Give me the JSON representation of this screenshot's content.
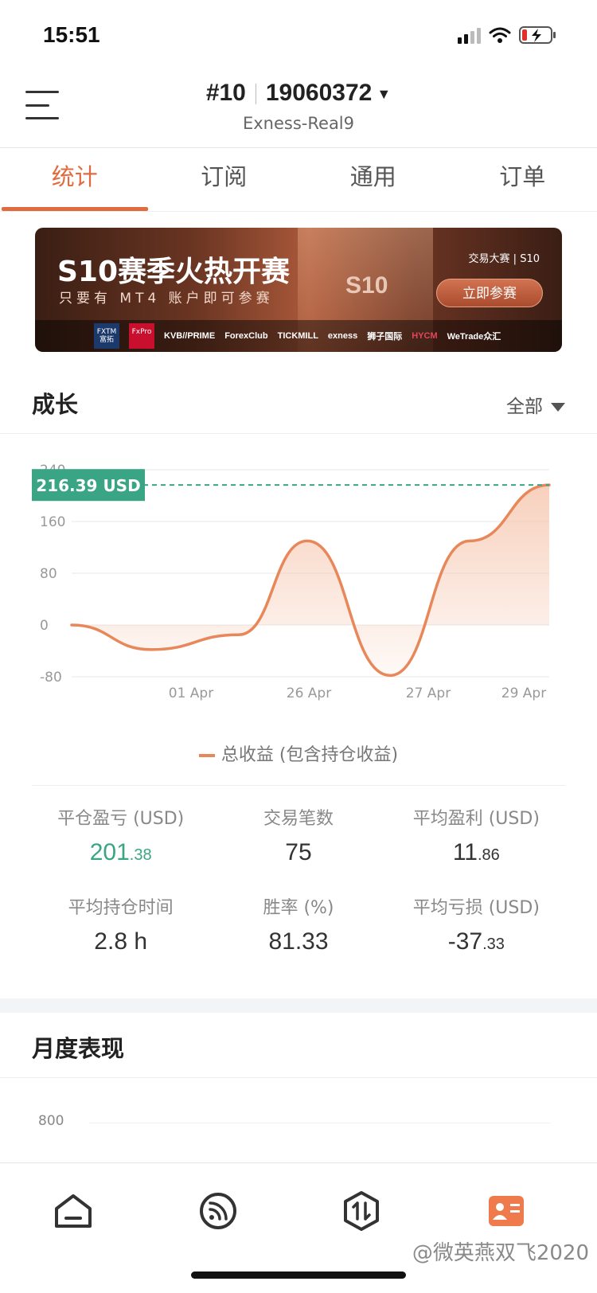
{
  "status_bar": {
    "time": "15:51"
  },
  "header": {
    "rank": "#10",
    "account_number": "19060372",
    "server": "Exness-Real9"
  },
  "tabs": [
    {
      "label": "统计",
      "active": true
    },
    {
      "label": "订阅",
      "active": false
    },
    {
      "label": "通用",
      "active": false
    },
    {
      "label": "订单",
      "active": false
    }
  ],
  "banner": {
    "title": "S10赛季火热开赛",
    "subtitle": "只要有 MT4 账户即可参赛",
    "brand": "交易大赛 | S10",
    "stage_mark": "S10",
    "cta": "立即参赛",
    "sponsors": [
      "FXTM 富拓",
      "FxPro",
      "KVB//PRIME",
      "ForexClub",
      "TICKMILL",
      "exness",
      "狮子国际",
      "HYCM",
      "WeTrade众汇"
    ]
  },
  "growth": {
    "title": "成长",
    "range": "全部",
    "current_label": "216.39 USD",
    "legend": "总收益 (包含持仓收益)"
  },
  "chart_data": {
    "type": "area",
    "x": [
      "",
      "",
      "01 Apr",
      "",
      "26 Apr",
      "",
      "27 Apr",
      "",
      "29 Apr"
    ],
    "xticks": [
      "01 Apr",
      "26 Apr",
      "27 Apr",
      "29 Apr"
    ],
    "yticks": [
      -80,
      0,
      80,
      160,
      240
    ],
    "ylim": [
      -80,
      240
    ],
    "series": [
      {
        "values": [
          0,
          -38,
          -15,
          130,
          -78,
          130,
          216.39
        ]
      }
    ],
    "reference_line": 216.39,
    "colors": {
      "line": "#e8885a",
      "fill": "#f6c8b1",
      "ref": "#3aa584"
    }
  },
  "stats": [
    {
      "label": "平仓盈亏 (USD)",
      "int": "201",
      "dec": ".38",
      "green": true
    },
    {
      "label": "交易笔数",
      "int": "75",
      "dec": "",
      "green": false
    },
    {
      "label": "平均盈利 (USD)",
      "int": "11",
      "dec": ".86",
      "green": false
    },
    {
      "label": "平均持仓时间",
      "int": "2.8 h",
      "dec": "",
      "green": false
    },
    {
      "label": "胜率 (%)",
      "int": "81.33",
      "dec": "",
      "green": false
    },
    {
      "label": "平均亏损 (USD)",
      "int": "-37",
      "dec": ".33",
      "green": false
    }
  ],
  "monthly": {
    "title": "月度表现",
    "axis_top": "800"
  },
  "bottom_nav": [
    {
      "icon": "home-icon"
    },
    {
      "icon": "subscription-feed-icon"
    },
    {
      "icon": "trade-exchange-icon"
    },
    {
      "icon": "profile-card-icon",
      "active": true
    }
  ],
  "watermark": "@微英燕双飞2020",
  "accent_color": "#e06b3e"
}
